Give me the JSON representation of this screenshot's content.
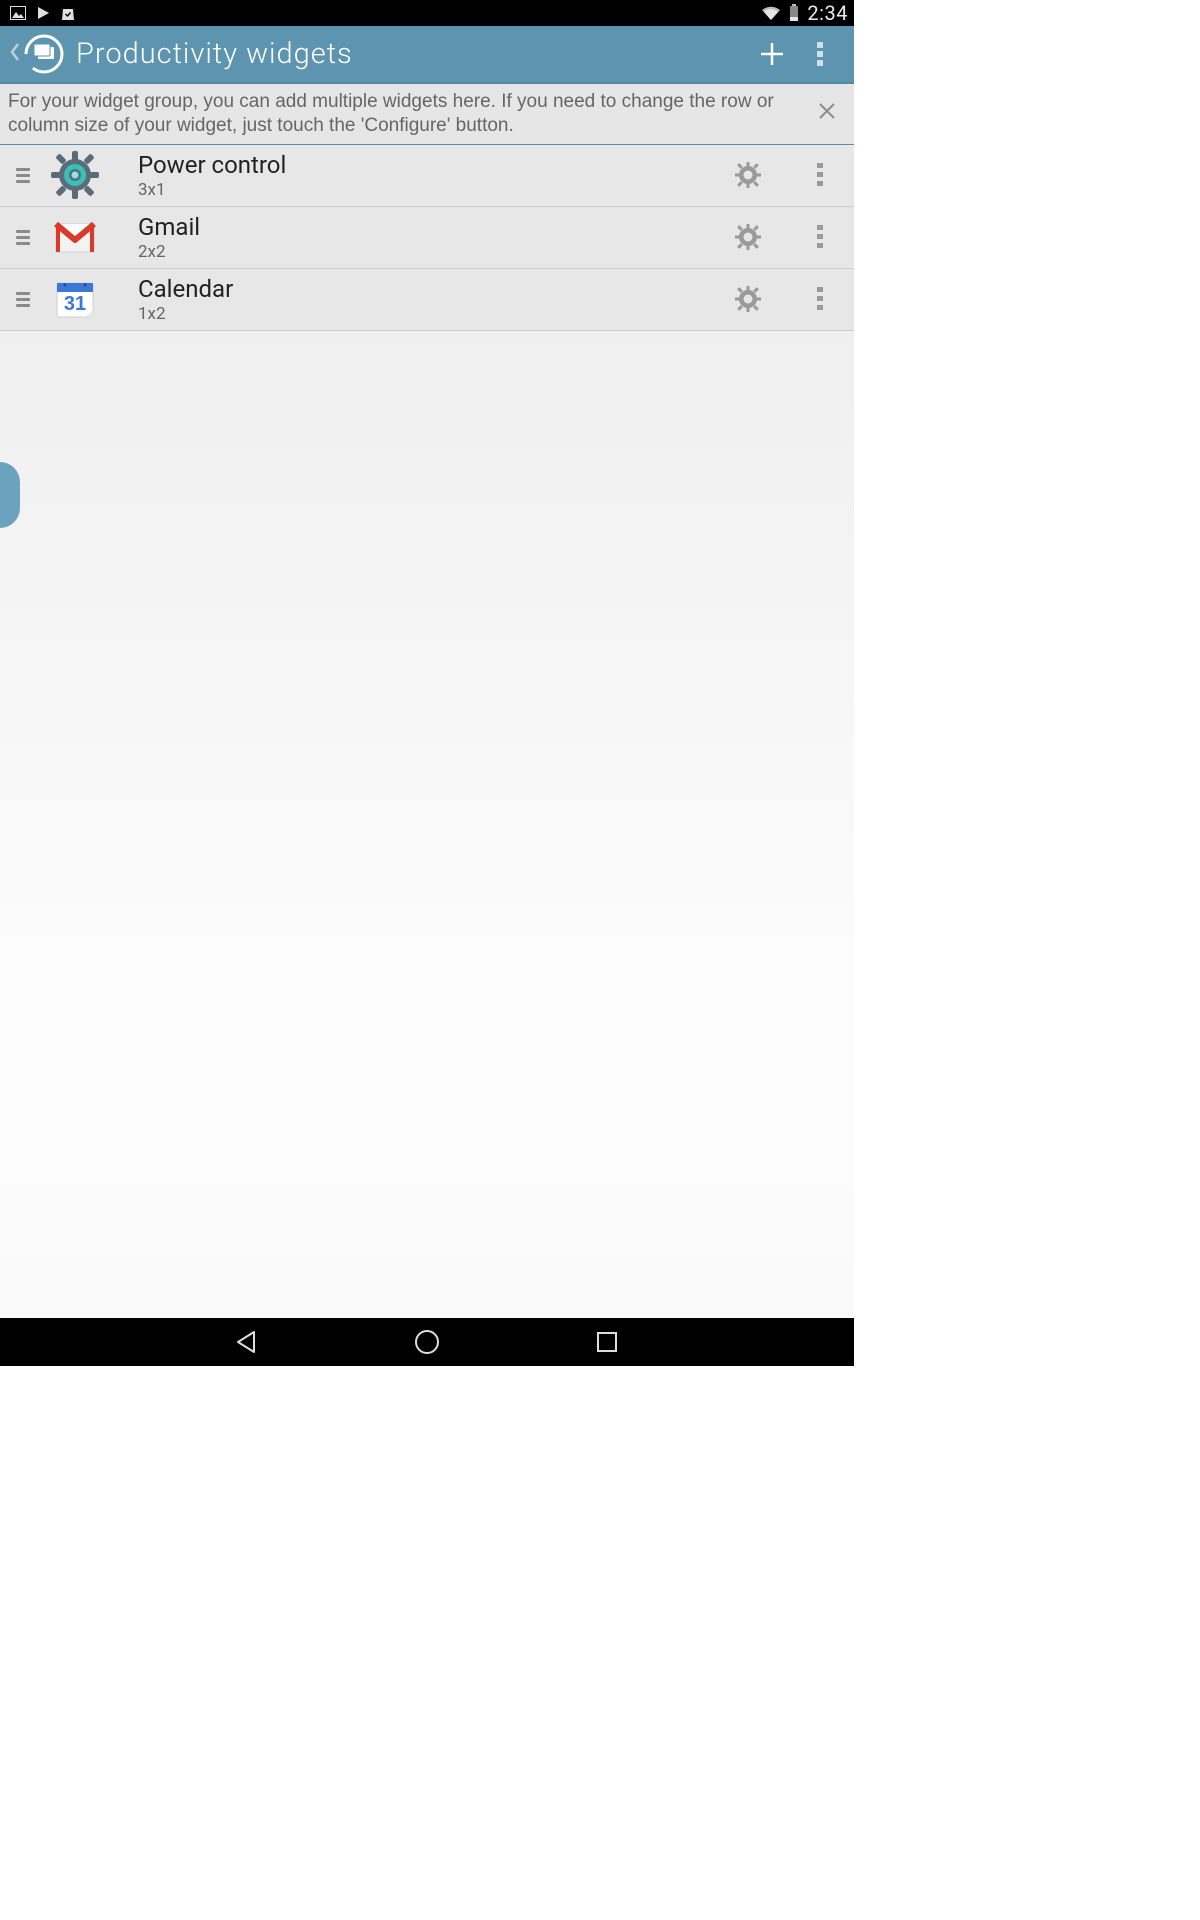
{
  "status": {
    "time": "2:34"
  },
  "appbar": {
    "title": "Productivity widgets"
  },
  "hint": {
    "text": "For your widget group, you can add multiple widgets here. If you need to change the row or column size of your widget, just touch the 'Configure' button."
  },
  "widgets": [
    {
      "name": "Power control",
      "size": "3x1",
      "icon": "settings"
    },
    {
      "name": "Gmail",
      "size": "2x2",
      "icon": "gmail"
    },
    {
      "name": "Calendar",
      "size": "1x2",
      "icon": "calendar"
    }
  ]
}
